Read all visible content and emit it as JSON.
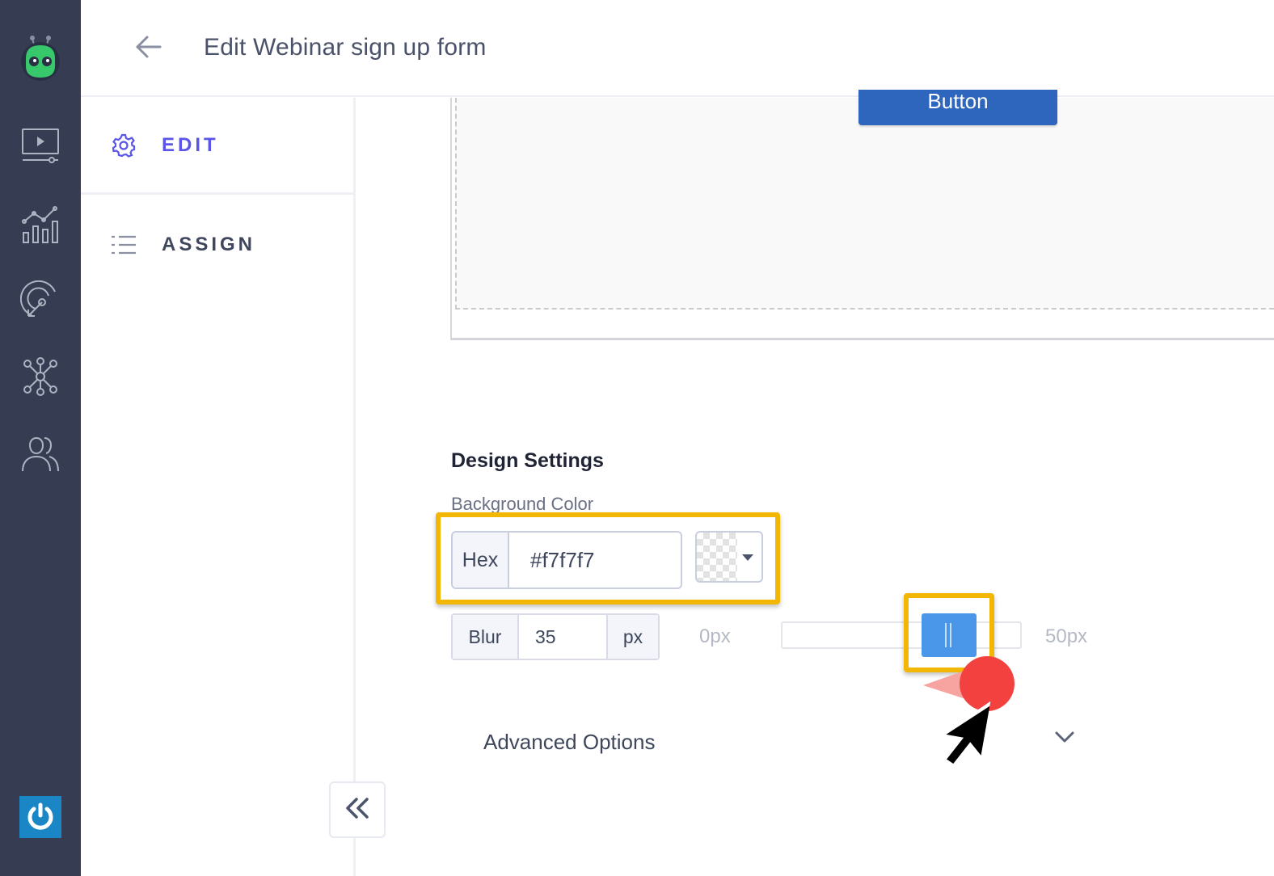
{
  "header": {
    "title": "Edit Webinar sign up form"
  },
  "side_menu": {
    "items": [
      {
        "label": "EDIT",
        "icon": "gear-icon",
        "active": true
      },
      {
        "label": "ASSIGN",
        "icon": "list-icon",
        "active": false
      }
    ]
  },
  "rail": {
    "icons": [
      "robot-logo-icon",
      "video-icon",
      "analytics-icon",
      "target-icon",
      "network-icon",
      "users-icon",
      "power-icon"
    ]
  },
  "preview": {
    "button_label": "Button"
  },
  "design": {
    "title": "Design Settings",
    "bg_label": "Background Color",
    "hex_addon": "Hex",
    "hex_value": "#f7f7f7",
    "blur_label": "Blur",
    "blur_value": "35",
    "blur_unit": "px",
    "range_min": "0px",
    "range_max": "50px",
    "advanced_label": "Advanced Options"
  },
  "colors": {
    "rail": "#363d52",
    "accent": "#5a55e6",
    "highlight": "#f2b705",
    "slider_thumb": "#4a97e9",
    "preview_button": "#2f66bd"
  }
}
